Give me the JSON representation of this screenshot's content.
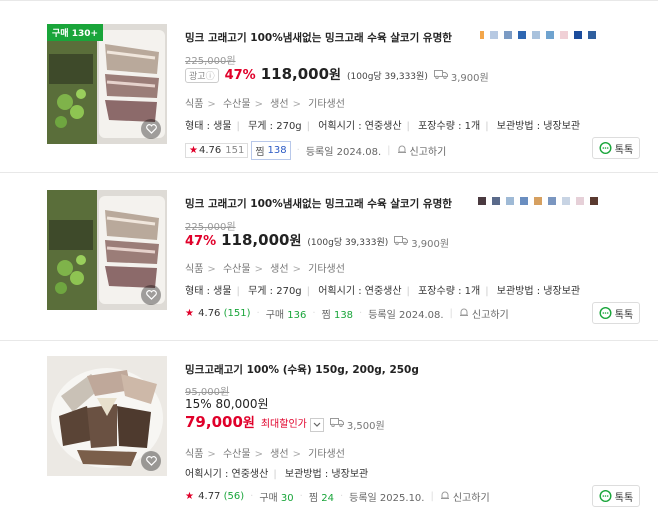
{
  "items": [
    {
      "buy_badge": "구매 130+",
      "title": "밍크 고래고기 100%냄새없는 밍크고래 수육 살코기 유명한",
      "original_price": "225,000원",
      "ad_label": "광고",
      "discount": "47%",
      "price": "118,000",
      "won": "원",
      "unit_price": "(100g당 39,333원)",
      "shipping": "3,900원",
      "categories": [
        "식품",
        "수산물",
        "생선",
        "기타생선"
      ],
      "specs": [
        "형태 : 생물",
        "무게 : 270g",
        "어획시기 : 연중생산",
        "포장수량 : 1개",
        "보관방법 : 냉장보관"
      ],
      "rating": "4.76",
      "reviews": "151",
      "zzim_label": "찜",
      "zzim": "138",
      "registered": "등록일 2024.08.",
      "report": "신고하기",
      "talk": "톡톡"
    },
    {
      "title": "밍크 고래고기 100%냄새없는 밍크고래 수육 살코기 유명한",
      "original_price": "225,000원",
      "discount": "47%",
      "price": "118,000",
      "won": "원",
      "unit_price": "(100g당 39,333원)",
      "shipping": "3,900원",
      "categories": [
        "식품",
        "수산물",
        "생선",
        "기타생선"
      ],
      "specs": [
        "형태 : 생물",
        "무게 : 270g",
        "어획시기 : 연중생산",
        "포장수량 : 1개",
        "보관방법 : 냉장보관"
      ],
      "rating": "4.76",
      "reviews": "(151)",
      "buy_label": "구매",
      "buy_count": "136",
      "zzim_label": "찜",
      "zzim": "138",
      "registered": "등록일 2024.08.",
      "report": "신고하기",
      "talk": "톡톡"
    },
    {
      "title": "밍크고래고기 100% (수육) 150g, 200g, 250g",
      "original_price": "95,000원",
      "discount_text": "15% 80,000원",
      "max_price": "79,000",
      "won": "원",
      "max_label": "최대할인가",
      "shipping": "3,500원",
      "categories": [
        "식품",
        "수산물",
        "생선",
        "기타생선"
      ],
      "specs": [
        "어획시기 : 연중생산",
        "보관방법 : 냉장보관"
      ],
      "rating": "4.77",
      "reviews": "(56)",
      "buy_label": "구매",
      "buy_count": "30",
      "zzim_label": "찜",
      "zzim": "24",
      "registered": "등록일 2025.10.",
      "report": "신고하기",
      "talk": "톡톡"
    }
  ],
  "icons": {
    "shipping": "truck-icon",
    "report": "siren-icon",
    "talk": "chat-bubble-icon",
    "wish": "heart-icon",
    "dropdown": "chevron-down-icon"
  },
  "colors": {
    "discount": "#e0002a",
    "green": "#19a53a",
    "blue": "#2b59c3"
  }
}
